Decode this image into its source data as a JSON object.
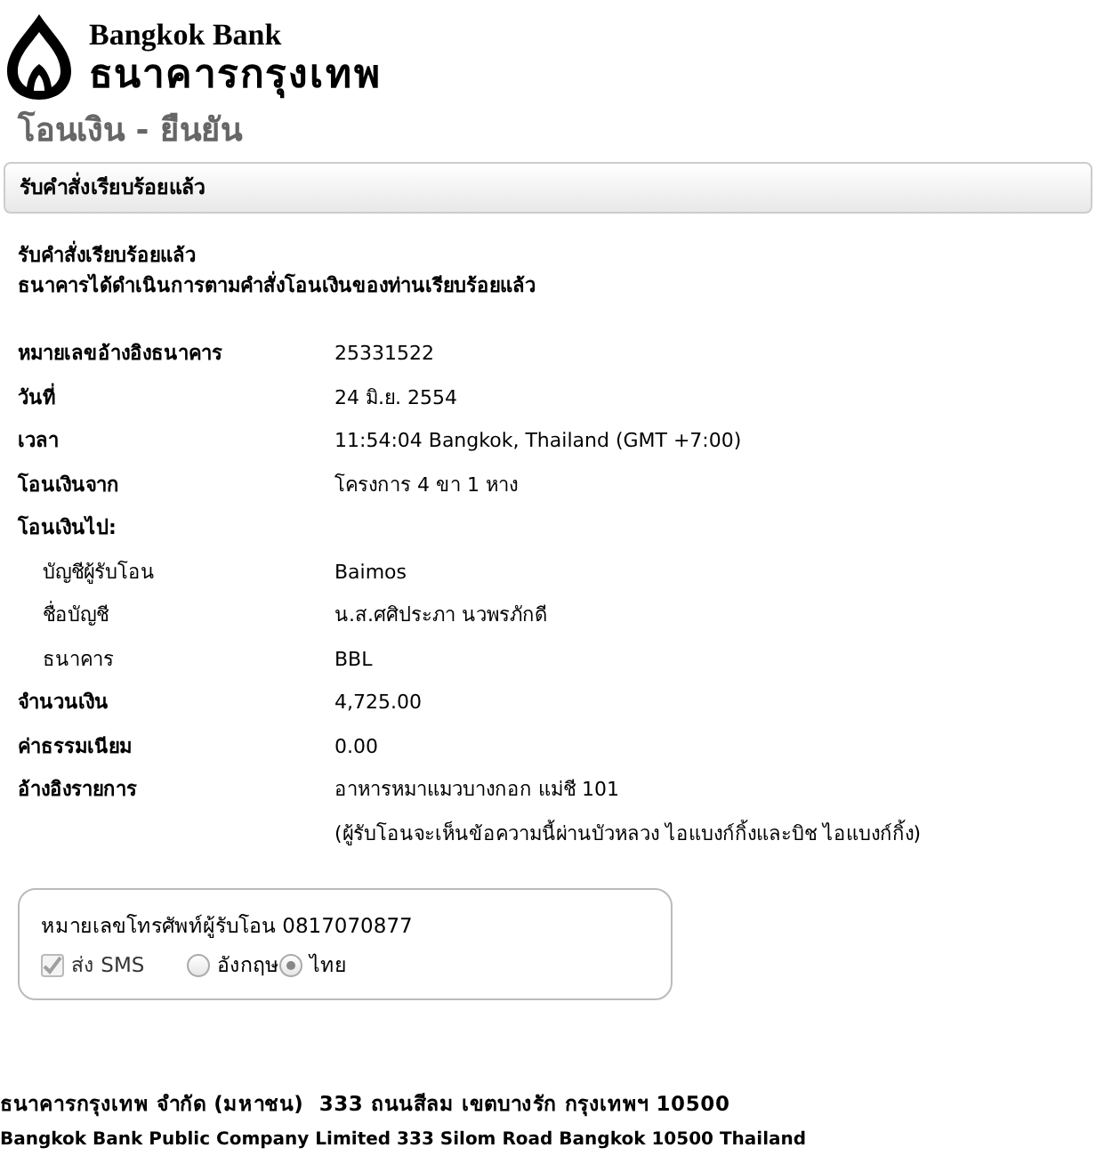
{
  "logo": {
    "english": "Bangkok Bank",
    "thai": "ธนาคารกรุงเทพ"
  },
  "page_title": "โอนเงิน - ยืนยัน",
  "panel_header": "รับคำสั่งเรียบร้อยแล้ว",
  "messages": [
    "รับคำสั่งเรียบร้อยแล้ว",
    "ธนาคารได้ดำเนินการตามคำสั่งโอนเงินของท่านเรียบร้อยแล้ว"
  ],
  "details": [
    {
      "kind": "main",
      "label": "หมายเลขอ้างอิงธนาคาร",
      "values": [
        "25331522"
      ]
    },
    {
      "kind": "main",
      "label": "วันที่",
      "values": [
        "24 มิ.ย. 2554"
      ]
    },
    {
      "kind": "main",
      "label": "เวลา",
      "values": [
        "11:54:04 Bangkok, Thailand (GMT +7:00)"
      ]
    },
    {
      "kind": "main",
      "label": "โอนเงินจาก",
      "values": [
        "โครงการ 4 ขา 1 หาง"
      ]
    },
    {
      "kind": "main",
      "label": "โอนเงินไป:"
    },
    {
      "kind": "sub",
      "label": "บัญชีผู้รับโอน",
      "values": [
        "Baimos"
      ]
    },
    {
      "kind": "sub",
      "label": "ชื่อบัญชี",
      "values": [
        "น.ส.ศศิประภา นวพรภักดี"
      ]
    },
    {
      "kind": "sub",
      "label": "ธนาคาร",
      "values": [
        "BBL"
      ]
    },
    {
      "kind": "main",
      "label": "จำนวนเงิน",
      "values": [
        "4,725.00"
      ]
    },
    {
      "kind": "main",
      "label": "ค่าธรรมเนียม",
      "values": [
        "0.00"
      ]
    },
    {
      "kind": "main",
      "label": "อ้างอิงรายการ",
      "values": [
        "อาหารหมาแมวบางกอก แม่ชี 101",
        "(ผู้รับโอนจะเห็นข้อความนี้ผ่านบัวหลวง ไอแบงก์กิ้งและบิช ไอแบงก์กิ้ง)"
      ]
    }
  ],
  "sms": {
    "phone_text": "หมายเลขโทรศัพท์ผู้รับโอน 0817070877",
    "send_sms": {
      "label": "ส่ง SMS",
      "checked": true,
      "disabled": true
    },
    "languages": [
      {
        "label": "อังกฤษ",
        "selected": false
      },
      {
        "label": "ไทย",
        "selected": true
      }
    ]
  },
  "footer": [
    "ธนาคารกรุงเทพ จำกัด (มหาชน)  333 ถนนสีลม เขตบางรัก กรุงเทพฯ 10500",
    "Bangkok Bank Public Company Limited 333 Silom Road Bangkok 10500 Thailand"
  ]
}
